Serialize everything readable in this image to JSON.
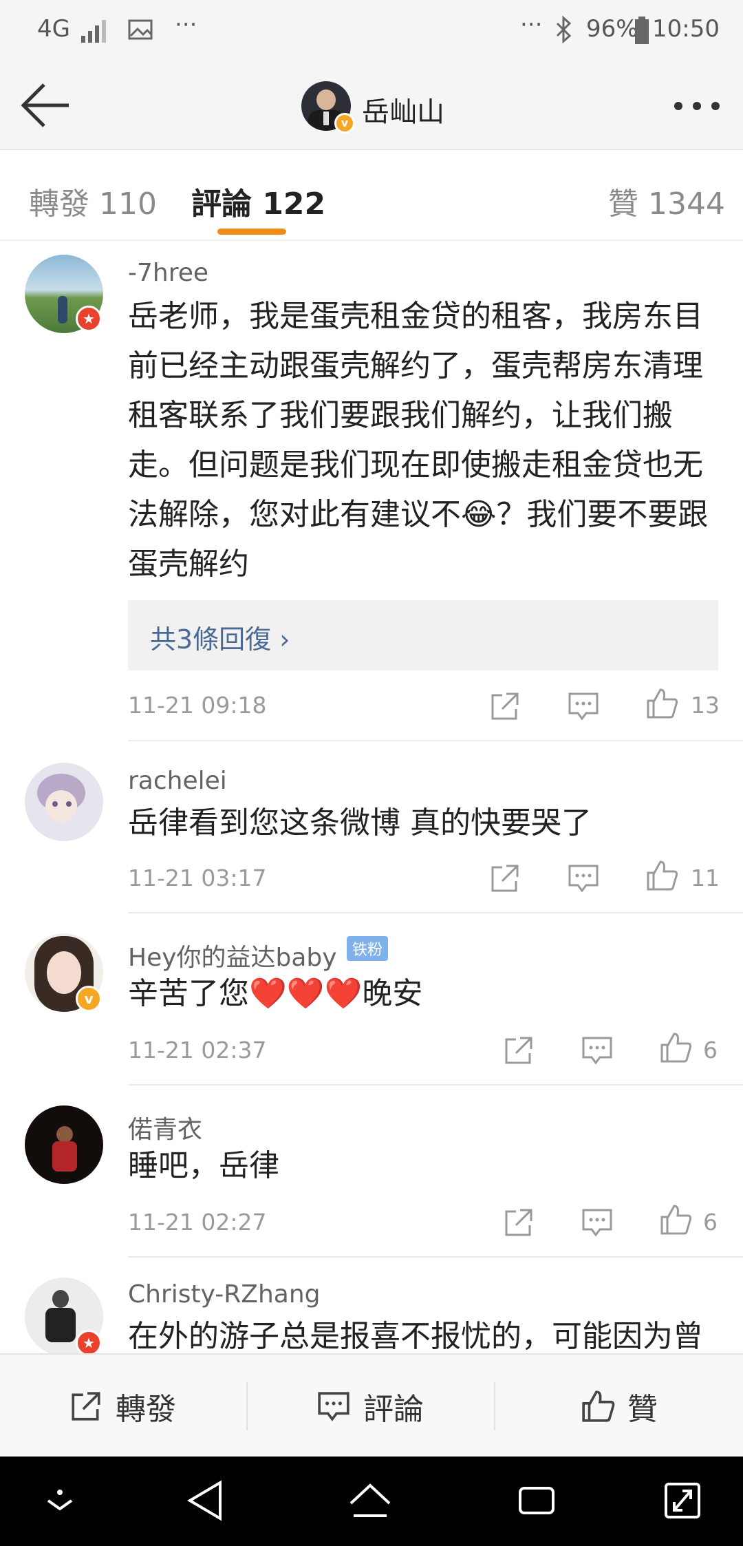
{
  "status_bar": {
    "network": "4G",
    "dots_left": "···",
    "dots_right": "···",
    "battery": "96%",
    "time": "10:50"
  },
  "header": {
    "username": "岳屾山",
    "badge": "v"
  },
  "tabs": [
    {
      "label": "轉發 110"
    },
    {
      "label": "評論 122"
    },
    {
      "label": "贊 1344"
    }
  ],
  "comments": [
    {
      "username": "-7hree",
      "text_lines": [
        "岳老师，我是蛋壳租金贷的租客，我房东目",
        "前已经主动跟蛋壳解约了，蛋壳帮房东清理",
        "租客联系了我们要跟我们解约，让我们搬",
        "走。但问题是我们现在即使搬走租金贷也无",
        "法解除，您对此有建议不😂？我们要不要跟",
        "蛋壳解约"
      ],
      "replies_label": "共3條回復 ›",
      "time": "11-21 09:18",
      "likes": "13"
    },
    {
      "username": "rachelei",
      "text_lines": [
        "岳律看到您这条微博 真的快要哭了"
      ],
      "time": "11-21 03:17",
      "likes": "11"
    },
    {
      "username": "Hey你的益达baby",
      "fan_badge": "铁粉",
      "text_lines": [
        "辛苦了您❤️❤️❤️晚安"
      ],
      "time": "11-21 02:37",
      "likes": "6"
    },
    {
      "username": "偌青衣",
      "text_lines": [
        "睡吧，岳律"
      ],
      "time": "11-21 02:27",
      "likes": "6"
    },
    {
      "username": "Christy-RZhang",
      "text_lines": [
        "在外的游子总是报喜不报忧的，可能因为曾"
      ]
    }
  ],
  "bottom_bar": {
    "repost": "轉發",
    "comment": "評論",
    "like": "贊"
  },
  "icons": {
    "back": "arrow-left-icon",
    "more": "more-dots-icon",
    "share": "share-icon",
    "reply": "comment-icon",
    "like": "thumbs-up-icon"
  },
  "colors": {
    "accent": "#f08c18",
    "link": "#4a6a95",
    "badge_red": "#e8412c",
    "badge_gold": "#f5a623"
  }
}
